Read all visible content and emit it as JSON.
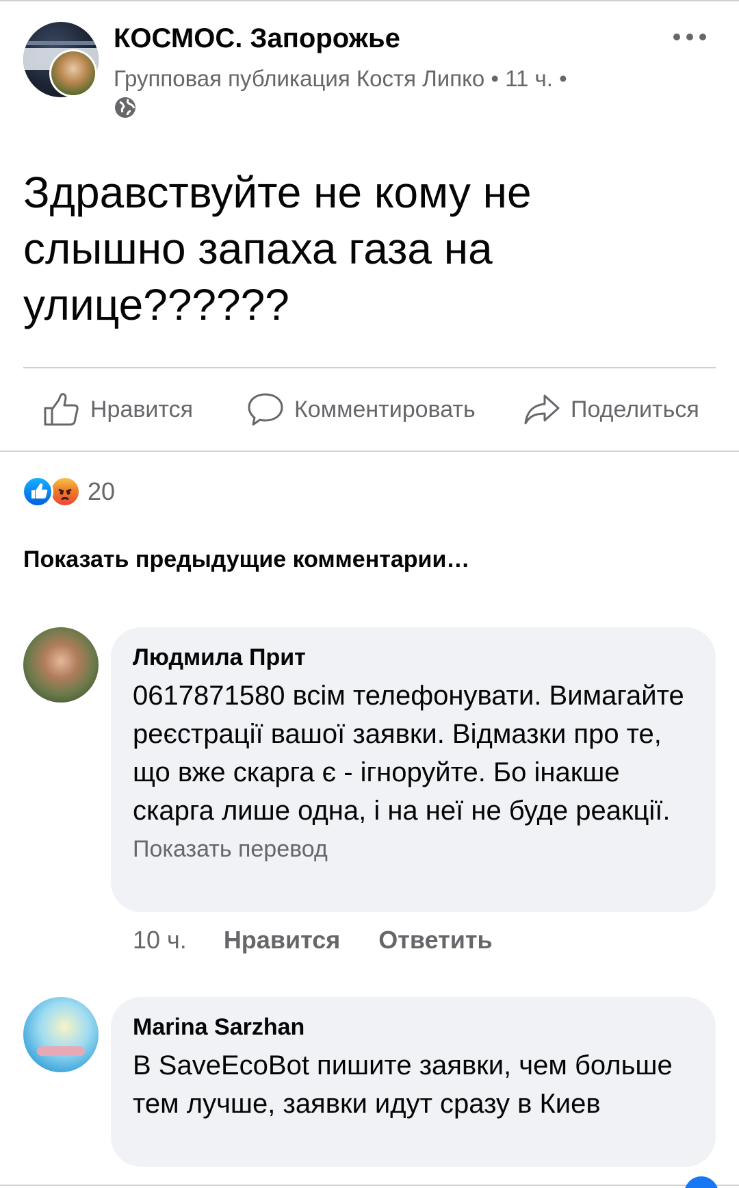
{
  "post": {
    "group_name": "КОСМОС. Запорожье",
    "meta": "Групповая публикация Костя Липко • 11 ч. •",
    "text": "Здравствуйте не кому не слышно запаха газа на улице??????",
    "icons": {
      "privacy": "globe-icon",
      "more": "more-icon"
    }
  },
  "actions": {
    "like_label": "Нравится",
    "comment_label": "Комментировать",
    "share_label": "Поделиться"
  },
  "reactions": {
    "types": [
      "like",
      "angry"
    ],
    "count": "20"
  },
  "previous_comments_label": "Показать предыдущие комментарии…",
  "comments": [
    {
      "author": "Людмила Прит",
      "text": "0617871580 всім телефонувати. Вимагайте реєстрації вашої заявки. Відмазки про те, що вже скарга є - ігноруйте. Бо інакше скарга лише одна, і на неї не буде реакції.",
      "translate_label": "Показать перевод",
      "time": "10 ч.",
      "like_label": "Нравится",
      "reply_label": "Ответить"
    },
    {
      "author": "Marina Sarzhan",
      "text": "В SaveEcoBot пишите заявки, чем больше тем лучше, заявки идут сразу в Киев"
    }
  ],
  "colors": {
    "primary_text": "#050505",
    "secondary_text": "#65676b",
    "comment_bubble": "#f0f2f5",
    "divider": "#ced0d4",
    "like_blue": "#1877f2"
  }
}
